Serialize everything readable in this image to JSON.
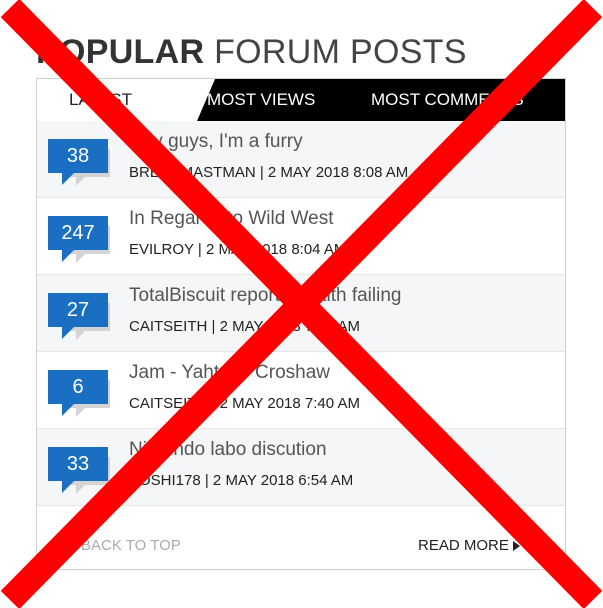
{
  "header": {
    "title_bold": "POPULAR",
    "title_light": "FORUM POSTS"
  },
  "tabs": [
    {
      "label": "LATEST",
      "active": true
    },
    {
      "label": "MOST VIEWS",
      "active": false
    },
    {
      "label": "MOST COMMENTS",
      "active": false
    }
  ],
  "posts": [
    {
      "count": "38",
      "title": "Hey guys, I'm a furry",
      "meta": "BREADMASTMAN | 2 MAY 2018 8:08 AM"
    },
    {
      "count": "247",
      "title": "In Regards to Wild West",
      "meta": "EVILROY | 2 MAY 2018 8:04 AM"
    },
    {
      "count": "27",
      "title": "TotalBiscuit reports health failing",
      "meta": "CAITSEITH | 2 MAY 2018 7:45 AM"
    },
    {
      "count": "6",
      "title": "Jam - Yahtzee Croshaw",
      "meta": "CAITSEITH | 2 MAY 2018 7:40 AM"
    },
    {
      "count": "33",
      "title": "Nintendo labo discution",
      "meta": "BOSHI178 | 2 MAY 2018 6:54 AM"
    }
  ],
  "footer": {
    "back_to_top": "BACK TO TOP",
    "read_more": "READ MORE"
  },
  "colors": {
    "accent_blue": "#1a6fc2",
    "cross_red": "#ff0000",
    "tab_bar": "#000000"
  },
  "icons": {
    "comment_bubble": "comment-bubble-icon",
    "read_more_arrow": "arrow-right-icon",
    "overlay": "red-x-cross-icon"
  }
}
